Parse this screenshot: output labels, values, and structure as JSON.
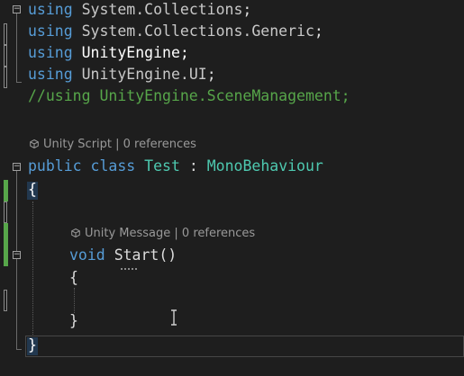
{
  "code": {
    "line1": {
      "kw": "using",
      "ns": "System.Collections",
      "end": ";"
    },
    "line2": {
      "kw": "using",
      "ns": "System.Collections.Generic",
      "end": ";"
    },
    "line3": {
      "kw": "using",
      "ns": "UnityEngine",
      "end": ";"
    },
    "line4": {
      "kw": "using",
      "ns": "UnityEngine.UI",
      "end": ";"
    },
    "line5": {
      "comment": "//using UnityEngine.SceneManagement;"
    },
    "lens1": "Unity Script | 0 references",
    "line7": {
      "kw1": "public",
      "kw2": "class",
      "name": "Test",
      "colon": ":",
      "base": "MonoBehaviour"
    },
    "line8": {
      "brace": "{"
    },
    "lens2": "Unity Message | 0 references",
    "line10": {
      "kw": "void",
      "name": "Start",
      "parens": "()"
    },
    "line11": {
      "brace": "{"
    },
    "line13": {
      "brace": "}"
    },
    "line14": {
      "brace": "}"
    }
  },
  "gutter": {
    "fold_symbol": "−"
  },
  "colors": {
    "background": "#1e1e1e",
    "keyword": "#569cd6",
    "type": "#4ec9b0",
    "comment": "#57a64a",
    "text": "#dcdcdc",
    "codelens": "#999999",
    "change_bar": "#57a64a"
  },
  "icons": {
    "codelens": "unity-cube-icon",
    "cursor": "text-ibeam-icon"
  }
}
